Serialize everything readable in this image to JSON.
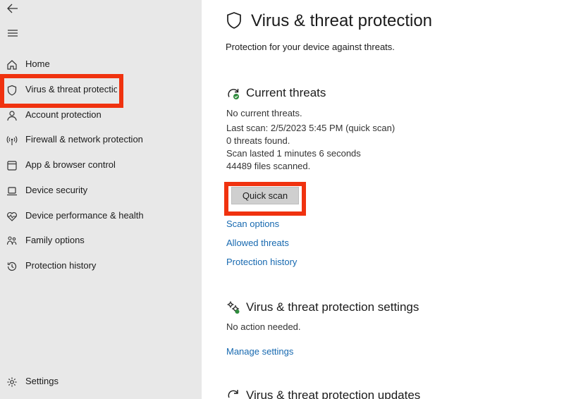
{
  "sidebar": {
    "back_icon": "back-arrow-icon",
    "menu_icon": "hamburger-menu-icon",
    "items": [
      {
        "label": "Home",
        "icon": "home-icon"
      },
      {
        "label": "Virus & threat protectio",
        "icon": "shield-icon",
        "highlighted": true
      },
      {
        "label": "Account protection",
        "icon": "person-icon"
      },
      {
        "label": "Firewall & network protection",
        "icon": "antenna-icon"
      },
      {
        "label": "App & browser control",
        "icon": "app-window-icon"
      },
      {
        "label": "Device security",
        "icon": "laptop-icon"
      },
      {
        "label": "Device performance & health",
        "icon": "heart-pulse-icon"
      },
      {
        "label": "Family options",
        "icon": "family-icon"
      },
      {
        "label": "Protection history",
        "icon": "history-icon"
      }
    ],
    "settings": {
      "label": "Settings",
      "icon": "gear-icon"
    }
  },
  "main": {
    "title": "Virus & threat protection",
    "subtitle": "Protection for your device against threats.",
    "current_threats": {
      "title": "Current threats",
      "lines": [
        "No current threats.",
        "Last scan: 2/5/2023 5:45 PM (quick scan)",
        "0 threats found.",
        "Scan lasted 1 minutes 6 seconds",
        "44489 files scanned."
      ],
      "button": "Quick scan",
      "links": [
        "Scan options",
        "Allowed threats",
        "Protection history"
      ]
    },
    "settings_section": {
      "title": "Virus & threat protection settings",
      "status": "No action needed.",
      "link": "Manage settings"
    },
    "updates_section": {
      "title": "Virus & threat protection updates"
    }
  },
  "colors": {
    "sidebar_bg": "#e8e8e8",
    "highlight": "#f0320f",
    "link": "#1769b0",
    "button_bg": "#cfcfcf"
  }
}
